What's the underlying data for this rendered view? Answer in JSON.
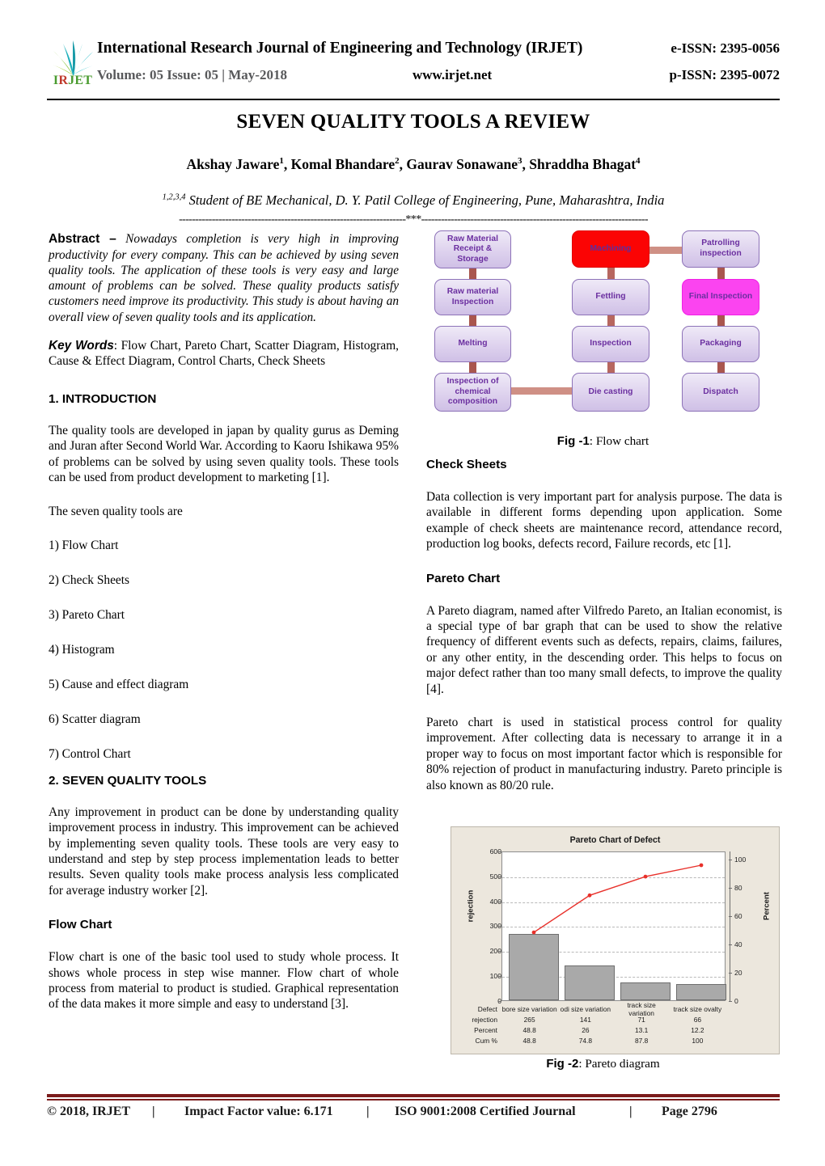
{
  "masthead": {
    "logo_text_i": "I",
    "logo_text_r": "R",
    "logo_text_jet": "JET",
    "journal_title": "International Research Journal of Engineering and Technology (IRJET)",
    "e_issn": "e-ISSN: 2395-0056",
    "volume_line": "Volume: 05 Issue: 05 | May-2018",
    "website": "www.irjet.net",
    "p_issn": "p-ISSN: 2395-0072"
  },
  "title_block": {
    "doc_title": "SEVEN QUALITY TOOLS A REVIEW",
    "authors_text": "Akshay Jaware",
    "author_sup_1": "1",
    "authors_text_2": ", Komal Bhandare",
    "author_sup_2": "2",
    "authors_text_3": ", Gaurav Sonawane",
    "author_sup_3": "3",
    "authors_text_4": ", Shraddha Bhagat",
    "author_sup_4": "4",
    "affiliation_sup": "1,2,3,4",
    "affiliation": "Student of BE Mechanical, D. Y. Patil College of Engineering, Pune, Maharashtra, India",
    "separator": "---------------------------------------------------------------------***---------------------------------------------------------------------"
  },
  "left_column": {
    "abstract_label": "Abstract –",
    "abstract_text": " Nowadays completion is very high in improving productivity for every company.  This can be achieved by using seven quality tools. The application of these tools is very easy and large amount of problems can be solved. These quality products satisfy customers need improve its productivity. This study is about having an overall view of seven quality tools and its application.",
    "keywords_label": "Key Words",
    "keywords_text": ":   Flow Chart, Pareto Chart, Scatter Diagram, Histogram, Cause & Effect Diagram, Control Charts, Check Sheets",
    "intro_heading": "1. INTRODUCTION",
    "intro_p1": "The quality tools are developed in japan by quality gurus as Deming and Juran after Second World War. According to Kaoru Ishikawa 95% of problems can be solved by using seven quality tools. These tools can be used from product development to marketing [1].",
    "intro_p2": "The seven quality tools are",
    "tools_list": [
      "1) Flow Chart",
      "2) Check Sheets",
      "3) Pareto Chart",
      "4) Histogram",
      "5) Cause and effect diagram",
      "6) Scatter diagram",
      "7) Control Chart"
    ],
    "section2_heading": "2. SEVEN QUALITY TOOLS",
    "section2_p1": "Any improvement in product can be done by understanding quality improvement process in industry. This improvement can be achieved by implementing seven quality tools. These tools are very easy to understand and step by step process implementation leads to better results. Seven quality tools make process analysis less complicated for average industry worker [2].",
    "flowchart_heading": "Flow Chart",
    "flowchart_p1": "Flow chart is one of the basic tool used to study whole process. It shows whole process in step wise manner. Flow chart of whole process from material to product is studied. Graphical representation of the data makes it more simple and easy to understand [3]."
  },
  "right_column": {
    "fig1_caption_bold": "Fig -1",
    "fig1_caption_rest": ": Flow chart",
    "check_sheets_heading": "Check Sheets",
    "check_sheets_p1": "Data collection is very important part for analysis purpose. The data is available in different forms depending upon application. Some example of check sheets are maintenance record, attendance record, production log books, defects record, Failure records, etc [1].",
    "pareto_heading": "Pareto Chart",
    "pareto_p1": "A Pareto diagram, named after Vilfredo Pareto, an Italian economist, is a special type of bar graph that can be used to show the relative frequency of different events such as defects, repairs, claims, failures, or any other entity, in the descending order. This helps to focus on major defect rather than too many small defects, to improve the quality [4].",
    "pareto_p2": "Pareto chart is used in statistical process control for quality improvement. After collecting data is necessary to arrange it in a proper way to focus on most important factor which is responsible for 80% rejection of product in manufacturing industry. Pareto principle is also known as 80/20 rule.",
    "fig2_caption_bold": "Fig -2",
    "fig2_caption_rest": ": Pareto diagram"
  },
  "flowchart": {
    "nodes": [
      {
        "id": "n1",
        "label": "Raw Material Receipt & Storage",
        "color": "lavender"
      },
      {
        "id": "n2",
        "label": "Raw material Inspection",
        "color": "lavender"
      },
      {
        "id": "n3",
        "label": "Melting",
        "color": "lavender"
      },
      {
        "id": "n4",
        "label": "Inspection of chemical composition",
        "color": "lavender"
      },
      {
        "id": "n5",
        "label": "Die casting",
        "color": "lavender"
      },
      {
        "id": "n6",
        "label": "Inspection",
        "color": "lavender"
      },
      {
        "id": "n7",
        "label": "Fettling",
        "color": "lavender"
      },
      {
        "id": "n8",
        "label": "Machining",
        "color": "red"
      },
      {
        "id": "n9",
        "label": "Patrolling inspection",
        "color": "lavender"
      },
      {
        "id": "n10",
        "label": "Final Inspection",
        "color": "magenta"
      },
      {
        "id": "n11",
        "label": "Packaging",
        "color": "lavender"
      },
      {
        "id": "n12",
        "label": "Dispatch",
        "color": "lavender"
      }
    ],
    "colors": {
      "lavender_fill": "#ded2ee",
      "lavender_border": "#8d72b8",
      "lavender_text": "#6b2fa0",
      "red_fill": "#fb0404",
      "magenta_fill": "#fb44f0",
      "connector": "#b7675f"
    }
  },
  "chart_data": {
    "type": "bar",
    "title": "Pareto Chart of Defect",
    "xlabel": "",
    "ylabel": "rejection",
    "y2label": "Percent",
    "categories": [
      "bore size variation",
      "odi size variation",
      "track size variation",
      "track size ovalty"
    ],
    "values": [
      265,
      141,
      71,
      66
    ],
    "series": [
      {
        "name": "rejection",
        "values": [
          265,
          141,
          71,
          66
        ]
      },
      {
        "name": "Cum %",
        "values": [
          48.8,
          74.8,
          87.8,
          100.0
        ]
      }
    ],
    "percent": [
      48.8,
      26.0,
      13.1,
      12.2
    ],
    "cum_percent": [
      48.8,
      74.8,
      87.8,
      100.0
    ],
    "ylim": [
      0,
      600
    ],
    "yticks": [
      0,
      100,
      200,
      300,
      400,
      500,
      600
    ],
    "y2lim": [
      0,
      100
    ],
    "y2ticks": [
      0,
      20,
      40,
      60,
      80,
      100
    ],
    "grid": true,
    "legend": "none",
    "row_labels": [
      "Defect",
      "rejection",
      "Percent",
      "Cum %"
    ],
    "bar_color": "#a9a9a9",
    "line_color": "#e8302a",
    "background": "#ece7dd"
  },
  "footer": {
    "copyright": "© 2018, IRJET",
    "bar1": "|",
    "impact": "Impact Factor value: 6.171",
    "bar2": "|",
    "iso": "ISO 9001:2008 Certified Journal",
    "bar3": "|",
    "page": "Page 2796"
  }
}
